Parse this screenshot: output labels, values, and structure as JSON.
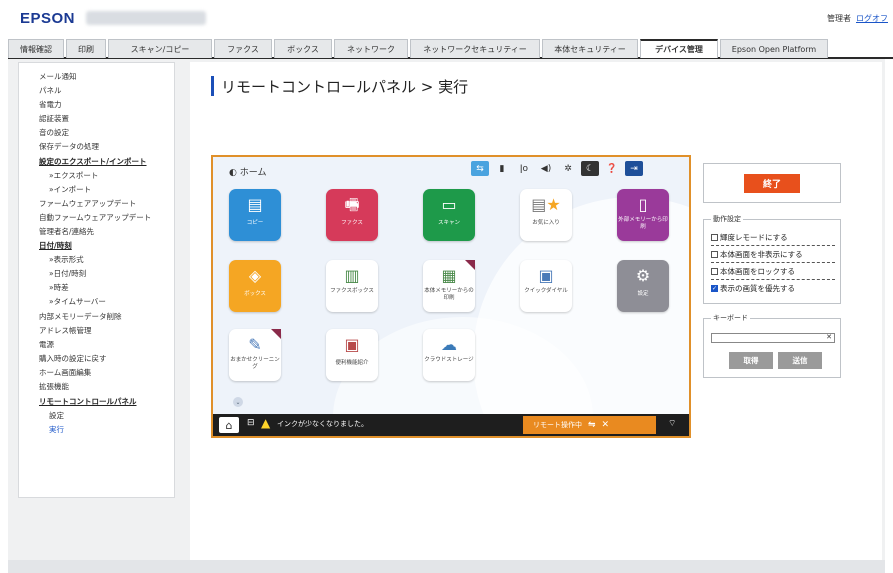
{
  "header": {
    "logo": "EPSON",
    "user_role": "管理者",
    "logout": "ログオフ"
  },
  "tabs": [
    {
      "label": "情報確認"
    },
    {
      "label": "印刷"
    },
    {
      "label": "スキャン/コピー"
    },
    {
      "label": "ファクス"
    },
    {
      "label": "ボックス"
    },
    {
      "label": "ネットワーク"
    },
    {
      "label": "ネットワークセキュリティー"
    },
    {
      "label": "本体セキュリティー"
    },
    {
      "label": "デバイス管理"
    },
    {
      "label": "Epson Open Platform"
    }
  ],
  "sidebar": {
    "items": [
      {
        "label": "メール通知"
      },
      {
        "label": "パネル"
      },
      {
        "label": "省電力"
      },
      {
        "label": "認証装置"
      },
      {
        "label": "音の設定"
      },
      {
        "label": "保存データの処理"
      },
      {
        "label": "設定のエクスポート/インポート"
      },
      {
        "label": "»エクスポート"
      },
      {
        "label": "»インポート"
      },
      {
        "label": "ファームウェアアップデート"
      },
      {
        "label": "自動ファームウェアアップデート"
      },
      {
        "label": "管理者名/連絡先"
      },
      {
        "label": "日付/時刻"
      },
      {
        "label": "»表示形式"
      },
      {
        "label": "»日付/時刻"
      },
      {
        "label": "»時差"
      },
      {
        "label": "»タイムサーバー"
      },
      {
        "label": "内部メモリーデータ削除"
      },
      {
        "label": "アドレス帳管理"
      },
      {
        "label": "電源"
      },
      {
        "label": "購入時の設定に戻す"
      },
      {
        "label": "ホーム画面編集"
      },
      {
        "label": "拡張機能"
      },
      {
        "label": "リモートコントロールパネル"
      },
      {
        "label": "設定"
      },
      {
        "label": "実行"
      }
    ]
  },
  "page_title": "リモートコントロールパネル > 実行",
  "panel": {
    "home_crumb": "ホーム",
    "apps": [
      {
        "label": "コピー",
        "icon": "copy-icon",
        "color": "#2e8fd6"
      },
      {
        "label": "ファクス",
        "icon": "fax-icon",
        "color": "#d63a5a"
      },
      {
        "label": "スキャン",
        "icon": "scan-icon",
        "color": "#1e9a4a"
      },
      {
        "label": "お気に入り",
        "icon": "favorite-icon",
        "color": "#ffffff"
      },
      {
        "label": "外部メモリーから印刷",
        "icon": "usb-icon",
        "color": "#9a3a9a"
      },
      {
        "label": "ボックス",
        "icon": "box-icon",
        "color": "#f5a623"
      },
      {
        "label": "ファクスボックス",
        "icon": "fax-box-icon",
        "color": "#ffffff"
      },
      {
        "label": "本体メモリーからの印刷",
        "icon": "internal-memory-icon",
        "color": "#ffffff"
      },
      {
        "label": "クイックダイヤル",
        "icon": "quick-dial-icon",
        "color": "#ffffff"
      },
      {
        "label": "設定",
        "icon": "settings-gear-icon",
        "color": "#8e8e96"
      },
      {
        "label": "おまかせクリーニング",
        "icon": "cleaning-icon",
        "color": "#ffffff"
      },
      {
        "label": "便利機能紹介",
        "icon": "feature-guide-icon",
        "color": "#ffffff"
      },
      {
        "label": "クラウドストレージ",
        "icon": "cloud-icon",
        "color": "#ffffff"
      }
    ],
    "bottom_message": "インクが少なくなりました。",
    "remote_status": "リモート操作中"
  },
  "finish_button": "終了",
  "operation_settings": {
    "legend": "動作設定",
    "options": [
      {
        "label": "輝度レモードにする",
        "checked": false
      },
      {
        "label": "本体画面を非表示にする",
        "checked": false
      },
      {
        "label": "本体画面をロックする",
        "checked": false
      },
      {
        "label": "表示の画質を優先する",
        "checked": true
      }
    ]
  },
  "keyboard": {
    "legend": "キーボード",
    "get_button": "取得",
    "send_button": "送信"
  },
  "colors": {
    "brand": "#1b3a93",
    "accent_orange": "#e8501c",
    "link": "#1a55c8"
  }
}
